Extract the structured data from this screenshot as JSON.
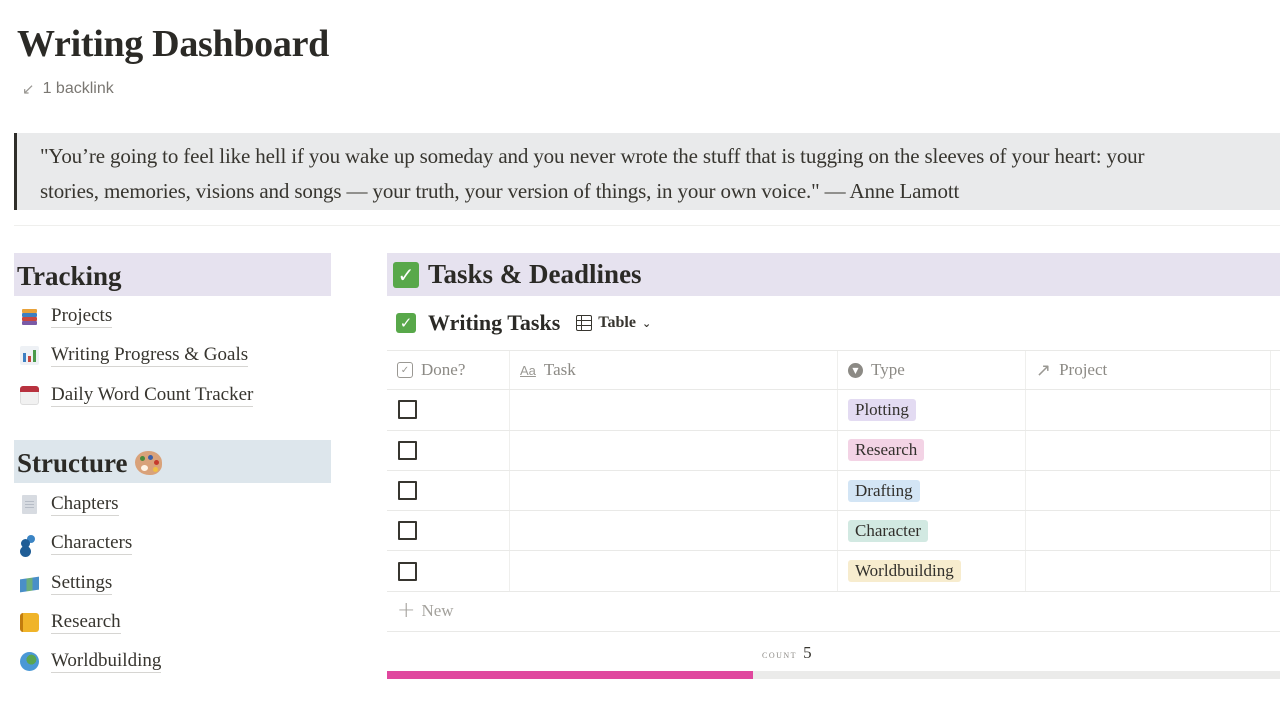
{
  "page": {
    "title": "Writing Dashboard",
    "backlink_label": "1 backlink"
  },
  "quote": {
    "line1": "\"You’re going to feel like hell if you wake up someday and you never wrote the stuff that is tugging on the sleeves of your heart: your",
    "line2": "stories, memories, visions and songs — your truth, your version of things, in your own voice.\" — Anne Lamott"
  },
  "tracking": {
    "heading": "Tracking",
    "items": [
      {
        "label": "Projects",
        "icon": "books-icon"
      },
      {
        "label": "Writing Progress & Goals",
        "icon": "bar-chart-icon"
      },
      {
        "label": "Daily Word Count Tracker",
        "icon": "calendar-icon"
      }
    ]
  },
  "structure": {
    "heading": "Structure",
    "heading_icon": "artist-palette-icon",
    "items": [
      {
        "label": "Chapters",
        "icon": "document-icon"
      },
      {
        "label": "Characters",
        "icon": "people-icon"
      },
      {
        "label": "Settings",
        "icon": "map-icon"
      },
      {
        "label": "Research",
        "icon": "notebook-icon"
      },
      {
        "label": "Worldbuilding",
        "icon": "globe-icon"
      }
    ]
  },
  "tasks": {
    "heading": "Tasks & Deadlines",
    "database": {
      "title": "Writing Tasks",
      "view_label": "Table",
      "columns": [
        {
          "label": "Done?",
          "icon": "checkbox-property-icon"
        },
        {
          "label": "Task",
          "icon": "title-property-icon"
        },
        {
          "label": "Type",
          "icon": "select-property-icon"
        },
        {
          "label": "Project",
          "icon": "relation-arrow-icon"
        }
      ],
      "rows": [
        {
          "done": false,
          "task": "",
          "type": "Plotting",
          "type_color": "#e3dbf2",
          "project": ""
        },
        {
          "done": false,
          "task": "",
          "type": "Research",
          "type_color": "#f3d3e5",
          "project": ""
        },
        {
          "done": false,
          "task": "",
          "type": "Drafting",
          "type_color": "#d3e5f5",
          "project": ""
        },
        {
          "done": false,
          "task": "",
          "type": "Character",
          "type_color": "#d2e9e2",
          "project": ""
        },
        {
          "done": false,
          "task": "",
          "type": "Worldbuilding",
          "type_color": "#f7ecce",
          "project": ""
        }
      ],
      "new_label": "New",
      "count_label": "COUNT",
      "count_value": "5",
      "progress_fraction": 0.41,
      "progress_color": "#e0479e"
    }
  }
}
